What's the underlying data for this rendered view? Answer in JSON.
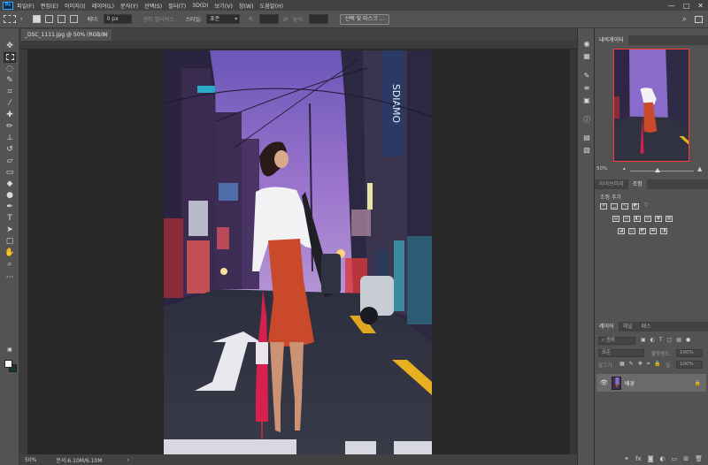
{
  "app": {
    "logo": "Ps"
  },
  "menu": [
    "파일(F)",
    "편집(E)",
    "이미지(I)",
    "레이어(L)",
    "문자(Y)",
    "선택(S)",
    "필터(T)",
    "3D(D)",
    "보기(V)",
    "창(W)",
    "도움말(H)"
  ],
  "window_controls": {
    "minimize": "—",
    "maximize": "□",
    "close": "✕"
  },
  "options": {
    "feather_label": "페더:",
    "feather_value": "0 px",
    "antialias_label": "앤티 앨리어스",
    "style_label": "스타일:",
    "style_value": "표준",
    "width_label": "폭:",
    "height_label": "높이:",
    "select_mask_button": "선택 및 마스크 ..."
  },
  "document": {
    "tab_title": "_DSC_1111.jpg @ 50% (RGB/8)",
    "close": "×"
  },
  "status": {
    "zoom": "50%",
    "doc_info": "문서:6.10M/6.10M",
    "arrow": "›"
  },
  "panels": {
    "navigator_tab": "내비게이터",
    "navigator_zoom": "50%",
    "library_tab": "라이브러리",
    "adjust_tab": "조정",
    "adjust_add": "조정 추가",
    "layers_tab": "레이어",
    "channels_tab": "채널",
    "paths_tab": "패스",
    "kind_placeholder": "종류",
    "blend_mode": "표준",
    "opacity_label": "불투명도:",
    "opacity_value": "100%",
    "lock_label": "잠그기:",
    "fill_label": "칠:",
    "fill_value": "100%",
    "layer_name": "배경"
  },
  "image": {
    "sign_text": "SDIAMO"
  },
  "colors": {
    "accent": "#31a8ff",
    "nav_frame": "#ff3838",
    "skirt": "#c9492a",
    "umbrella": "#d8204e",
    "sky": "#8466c8"
  }
}
